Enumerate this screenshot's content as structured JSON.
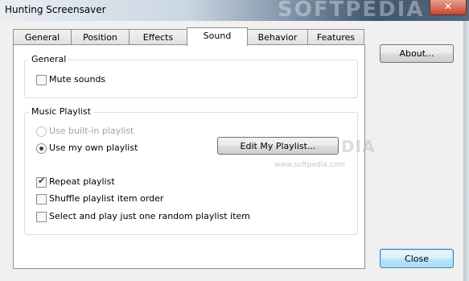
{
  "window": {
    "title": "Hunting Screensaver",
    "close_symbol": "✕",
    "watermark": "SOFTPEDIA"
  },
  "tabs": [
    {
      "label": "General"
    },
    {
      "label": "Position"
    },
    {
      "label": "Effects"
    },
    {
      "label": "Sound",
      "active": true
    },
    {
      "label": "Behavior"
    },
    {
      "label": "Features"
    }
  ],
  "general_group": {
    "title": "General",
    "mute_sounds": {
      "label": "Mute sounds",
      "checked": false
    }
  },
  "playlist_group": {
    "title": "Music Playlist",
    "builtin": {
      "label": "Use built-in playlist",
      "selected": false,
      "enabled": false
    },
    "own": {
      "label": "Use my own playlist",
      "selected": true,
      "enabled": true
    },
    "edit_button": "Edit My Playlist...",
    "repeat": {
      "label": "Repeat playlist",
      "checked": true
    },
    "shuffle": {
      "label": "Shuffle playlist item order",
      "checked": false
    },
    "random_one": {
      "label": "Select and play just one random playlist item",
      "checked": false
    }
  },
  "about_button": "About...",
  "close_button": "Close",
  "panel_watermark": {
    "big": "SOFTPEDIA",
    "small": "www.softpedia.com"
  },
  "colors": {
    "window_bg": "#f0f0f0",
    "panel_bg": "#ffffff",
    "default_button": "#bee6fd"
  }
}
